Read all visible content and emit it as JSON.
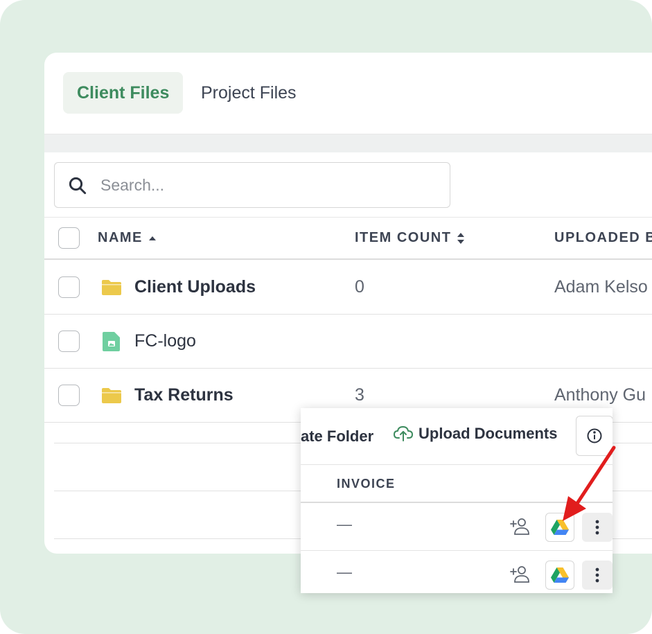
{
  "tabs": [
    {
      "label": "Client Files",
      "active": true
    },
    {
      "label": "Project Files",
      "active": false
    }
  ],
  "search": {
    "placeholder": "Search...",
    "value": ""
  },
  "table": {
    "columns": {
      "name": "NAME",
      "item_count": "ITEM COUNT",
      "uploaded_by": "UPLOADED B"
    },
    "rows": [
      {
        "name": "Client Uploads",
        "type": "folder",
        "item_count": "0",
        "uploaded_by": "Adam Kelso"
      },
      {
        "name": "FC-logo",
        "type": "image-file",
        "item_count": "",
        "uploaded_by": ""
      },
      {
        "name": "Tax Returns",
        "type": "folder",
        "item_count": "3",
        "uploaded_by": "Anthony Gu"
      }
    ]
  },
  "overlay": {
    "create_folder_label": "ate Folder",
    "upload_label": "Upload Documents",
    "invoice_header": "INVOICE",
    "rows": [
      {
        "invoice": "—"
      },
      {
        "invoice": "—"
      }
    ]
  },
  "colors": {
    "accent_green": "#3d8b5e",
    "background_mint": "#e1efe5",
    "folder_yellow": "#ecc94b",
    "file_green": "#6fcfa0",
    "arrow_red": "#e11d1d"
  },
  "icons": {
    "search": "search-icon",
    "sort_asc": "sort-asc-icon",
    "sort_both": "sort-icon",
    "folder": "folder-icon",
    "image_file": "image-file-icon",
    "cloud_upload": "cloud-upload-icon",
    "info": "info-icon",
    "add_user": "add-user-icon",
    "google_drive": "google-drive-icon",
    "more": "more-vertical-icon",
    "arrow": "red-arrow-icon"
  }
}
